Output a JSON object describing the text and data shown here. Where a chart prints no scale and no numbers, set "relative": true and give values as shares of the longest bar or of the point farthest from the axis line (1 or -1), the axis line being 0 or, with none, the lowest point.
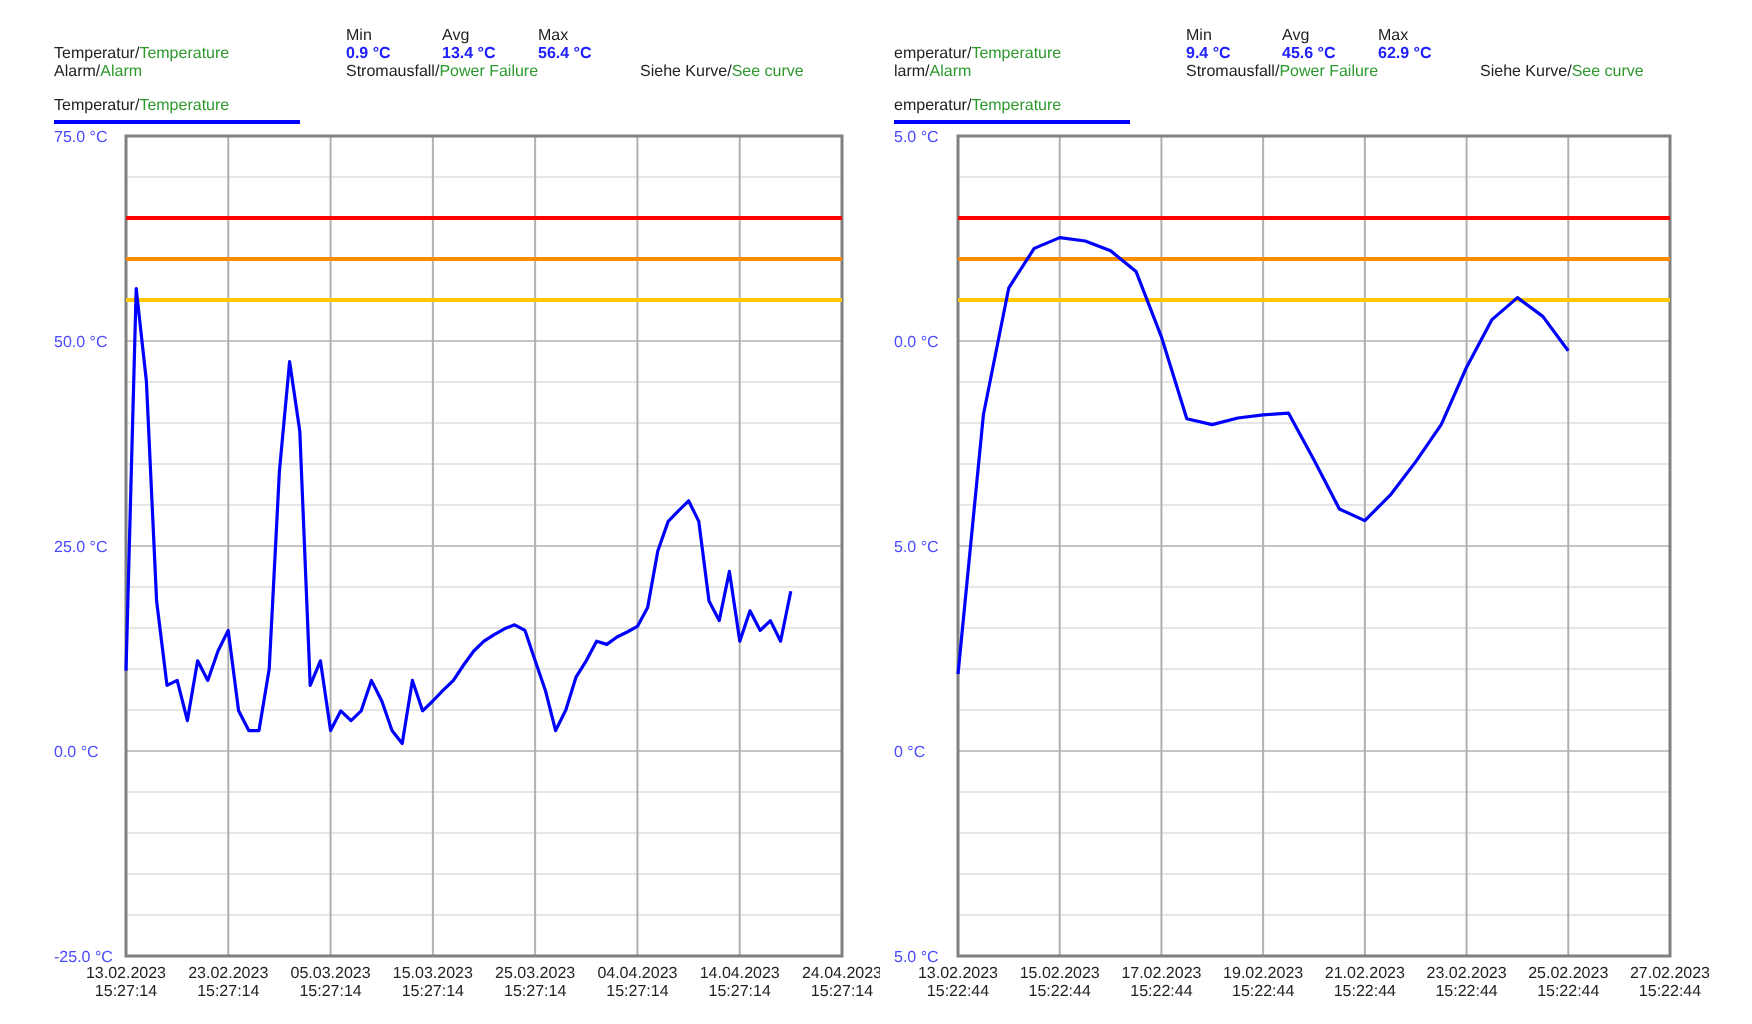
{
  "panels": [
    {
      "header": {
        "temperature": {
          "de": "Temperatur/",
          "en": "Temperature"
        },
        "alarm": {
          "de": "Alarm/",
          "en": "Alarm"
        },
        "stats": [
          {
            "label": "Min",
            "value": "0.9 °C"
          },
          {
            "label": "Avg",
            "value": "13.4 °C"
          },
          {
            "label": "Max",
            "value": "56.4 °C"
          }
        ],
        "power_failure": {
          "de": "Stromausfall/",
          "en": "Power Failure"
        },
        "see_curve": {
          "de": "Siehe Kurve/",
          "en": "See curve"
        }
      },
      "series_legend": {
        "de": "Temperatur/",
        "en": "Temperature"
      },
      "chart_data": {
        "type": "line",
        "grid": true,
        "ylim": [
          -25,
          75
        ],
        "categories": [
          "13.02.2023\n15:27:14",
          null,
          null,
          null,
          null,
          null,
          null,
          null,
          null,
          null,
          "23.02.2023\n15:27:14",
          null,
          null,
          null,
          null,
          null,
          null,
          null,
          null,
          null,
          "05.03.2023\n15:27:14",
          null,
          null,
          null,
          null,
          null,
          null,
          null,
          null,
          null,
          "15.03.2023\n15:27:14",
          null,
          null,
          null,
          null,
          null,
          null,
          null,
          null,
          null,
          "25.03.2023\n15:27:14",
          null,
          null,
          null,
          null,
          null,
          null,
          null,
          null,
          null,
          "04.04.2023\n15:27:14",
          null,
          null,
          null,
          null,
          null,
          null,
          null,
          null,
          null,
          "14.04.2023\n15:27:14",
          null,
          null,
          null,
          null,
          null,
          null,
          null,
          null,
          null,
          "24.04.2023\n15:27:14"
        ],
        "series": [
          {
            "color": "#0000ff",
            "values": [
              9.8,
              56.4,
              45.1,
              18.3,
              8.0,
              8.6,
              3.7,
              11.0,
              8.6,
              12.2,
              14.7,
              4.9,
              2.5,
              2.5,
              10.0,
              34.1,
              47.5,
              39.0,
              8.0,
              11.0,
              2.5,
              4.9,
              3.7,
              4.9,
              8.6,
              6.1,
              2.5,
              0.9,
              8.6,
              4.9,
              6.1,
              7.4,
              8.6,
              10.5,
              12.2,
              13.4,
              14.2,
              14.9,
              15.4,
              14.7,
              11.0,
              7.4,
              2.5,
              5.0,
              9.0,
              11.0,
              13.4,
              13.0,
              13.9,
              14.5,
              15.2,
              17.5,
              24.4,
              28.0,
              29.3,
              30.5,
              28.0,
              18.3,
              15.9,
              21.9,
              13.4,
              17.1,
              14.7,
              15.9,
              13.4,
              19.5,
              null,
              null,
              null,
              null,
              null
            ]
          }
        ],
        "yticks": [
          {
            "value": 75,
            "label": "75.0 °C"
          },
          {
            "value": 50,
            "label": "50.0 °C"
          },
          {
            "value": 25,
            "label": "25.0 °C"
          },
          {
            "value": 0,
            "label": "0.0 °C"
          },
          {
            "value": -25,
            "label": "-25.0 °C"
          }
        ],
        "ref_lines": [
          {
            "axis": "y",
            "value": 65,
            "color": "#ff0000"
          },
          {
            "axis": "y",
            "value": 60,
            "color": "#ff8c00"
          },
          {
            "axis": "y",
            "value": 55,
            "color": "#ffc800"
          }
        ]
      }
    },
    {
      "header": {
        "temperature": {
          "de": "emperatur/",
          "en": "Temperature"
        },
        "alarm": {
          "de": "larm/",
          "en": "Alarm"
        },
        "stats": [
          {
            "label": "Min",
            "value": "9.4 °C"
          },
          {
            "label": "Avg",
            "value": "45.6 °C"
          },
          {
            "label": "Max",
            "value": "62.9 °C"
          }
        ],
        "power_failure": {
          "de": "Stromausfall/",
          "en": "Power Failure"
        },
        "see_curve": {
          "de": "Siehe Kurve/",
          "en": "See curve"
        }
      },
      "series_legend": {
        "de": "emperatur/",
        "en": "Temperature"
      },
      "y_axis_labels": [
        "5.0 °C",
        "0.0 °C",
        "5.0 °C",
        "0 °C",
        "5.0 °C"
      ],
      "chart_data": {
        "type": "line",
        "relative": true,
        "grid": true,
        "ylim": [
          -25,
          75
        ],
        "categories": [
          "13.02.2023\n15:22:44",
          null,
          null,
          null,
          "15.02.2023\n15:22:44",
          null,
          null,
          null,
          "17.02.2023\n15:22:44",
          null,
          null,
          null,
          "19.02.2023\n15:22:44",
          null,
          null,
          null,
          "21.02.2023\n15:22:44",
          null,
          null,
          null,
          "23.02.2023\n15:22:44",
          null,
          null,
          null,
          "25.02.2023\n15:22:44",
          null,
          null,
          null,
          "27.02.2023\n15:22:44"
        ],
        "series": [
          {
            "color": "#0000ff",
            "values": [
              9.4,
              41.0,
              56.5,
              61.3,
              62.6,
              62.2,
              61.0,
              58.5,
              50.5,
              40.5,
              39.8,
              40.6,
              41.0,
              41.2,
              35.5,
              29.5,
              28.1,
              31.2,
              35.3,
              39.8,
              46.8,
              52.6,
              55.3,
              53.0,
              48.8,
              null,
              null,
              null,
              null
            ]
          }
        ],
        "ref_lines": [
          {
            "axis": "y",
            "value": 65,
            "color": "#ff0000"
          },
          {
            "axis": "y",
            "value": 60,
            "color": "#ff8c00"
          },
          {
            "axis": "y",
            "value": 55,
            "color": "#ffc800"
          }
        ]
      }
    }
  ]
}
